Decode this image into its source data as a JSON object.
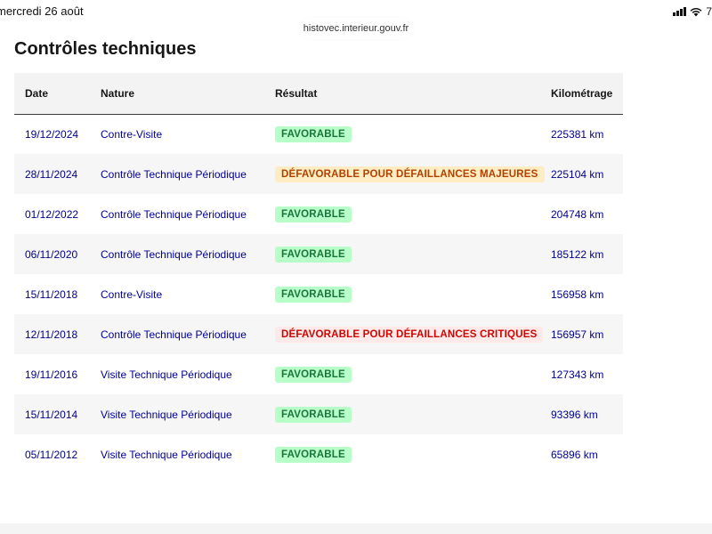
{
  "statusbar": {
    "time": "mercredi 26 août",
    "battery": "7"
  },
  "browser": {
    "url": "histovec.interieur.gouv.fr"
  },
  "section": {
    "title": "Contrôles techniques"
  },
  "table": {
    "headers": {
      "date": "Date",
      "nature": "Nature",
      "result": "Résultat",
      "mileage": "Kilométrage"
    },
    "rows": [
      {
        "date": "19/12/2024",
        "nature": "Contre-Visite",
        "result": "FAVORABLE",
        "status": "fav",
        "mileage": "225381 km"
      },
      {
        "date": "28/11/2024",
        "nature": "Contrôle Technique Périodique",
        "result": "DÉFAVORABLE POUR DÉFAILLANCES MAJEURES",
        "status": "def-maj",
        "mileage": "225104 km"
      },
      {
        "date": "01/12/2022",
        "nature": "Contrôle Technique Périodique",
        "result": "FAVORABLE",
        "status": "fav",
        "mileage": "204748 km"
      },
      {
        "date": "06/11/2020",
        "nature": "Contrôle Technique Périodique",
        "result": "FAVORABLE",
        "status": "fav",
        "mileage": "185122 km"
      },
      {
        "date": "15/11/2018",
        "nature": "Contre-Visite",
        "result": "FAVORABLE",
        "status": "fav",
        "mileage": "156958 km"
      },
      {
        "date": "12/11/2018",
        "nature": "Contrôle Technique Périodique",
        "result": "DÉFAVORABLE POUR DÉFAILLANCES CRITIQUES",
        "status": "def-crit",
        "mileage": "156957 km"
      },
      {
        "date": "19/11/2016",
        "nature": "Visite Technique Périodique",
        "result": "FAVORABLE",
        "status": "fav",
        "mileage": "127343 km"
      },
      {
        "date": "15/11/2014",
        "nature": "Visite Technique Périodique",
        "result": "FAVORABLE",
        "status": "fav",
        "mileage": "93396 km"
      },
      {
        "date": "05/11/2012",
        "nature": "Visite Technique Périodique",
        "result": "FAVORABLE",
        "status": "fav",
        "mileage": "65896 km"
      }
    ]
  },
  "colors": {
    "link_blue": "#000091",
    "favorable_bg": "#b8fec9",
    "favorable_text": "#18753c",
    "major_bg": "#feecc2",
    "major_text": "#b34000",
    "critical_bg": "#ffe9e9",
    "critical_text": "#ce0500"
  }
}
